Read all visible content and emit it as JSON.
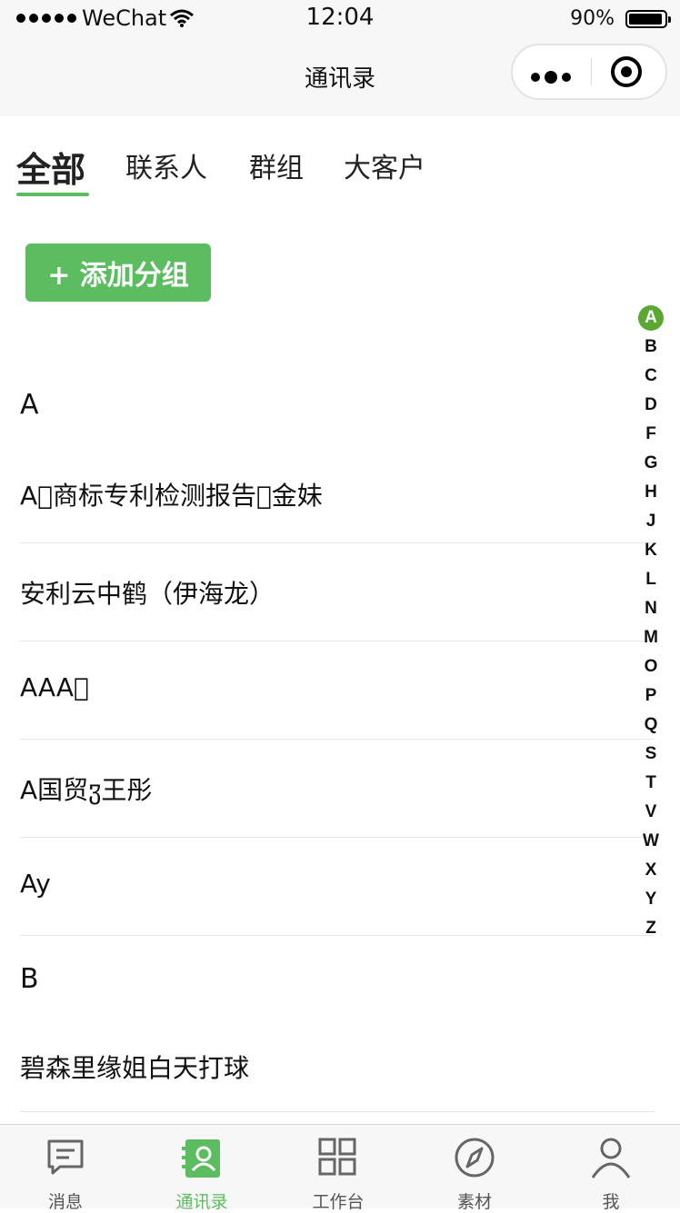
{
  "status_bar": {
    "carrier": "WeChat",
    "time": "12:04",
    "battery": "90%"
  },
  "nav": {
    "title": "通讯录"
  },
  "tabs": [
    {
      "label": "全部",
      "active": true
    },
    {
      "label": "联系人",
      "active": false
    },
    {
      "label": "群组",
      "active": false
    },
    {
      "label": "大客户",
      "active": false
    }
  ],
  "add_group_button": {
    "label": "+ 添加分组"
  },
  "sections": [
    {
      "letter": "A",
      "contacts": [
        "A\u0000商标专利检测报告\u0000金妹",
        "安利云中鹤（伊海龙）",
        "AAA\u0000",
        "A国贸ჳ王彤",
        "Ay"
      ]
    },
    {
      "letter": "B",
      "contacts": [
        "碧森里缘姐白天打球"
      ]
    }
  ],
  "index_letters": [
    "A",
    "B",
    "C",
    "D",
    "F",
    "G",
    "H",
    "J",
    "K",
    "L",
    "N",
    "M",
    "O",
    "P",
    "Q",
    "S",
    "T",
    "V",
    "W",
    "X",
    "Y",
    "Z"
  ],
  "index_active": "A",
  "tabbar": [
    {
      "label": "消息",
      "icon": "message-icon",
      "active": false
    },
    {
      "label": "通讯录",
      "icon": "contacts-icon",
      "active": true
    },
    {
      "label": "工作台",
      "icon": "workbench-icon",
      "active": false
    },
    {
      "label": "素材",
      "icon": "compass-icon",
      "active": false
    },
    {
      "label": "我",
      "icon": "user-icon",
      "active": false
    }
  ],
  "colors": {
    "accent": "#5bbd5f",
    "index_active": "#5aa832"
  }
}
